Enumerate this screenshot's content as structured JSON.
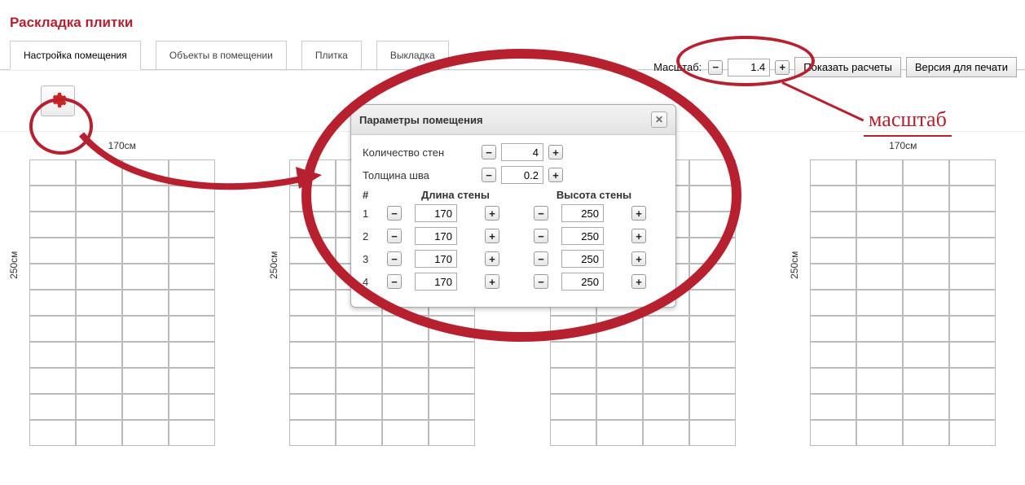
{
  "title": "Раскладка плитки",
  "tabs": [
    "Настройка помещения",
    "Объекты в помещении",
    "Плитка",
    "Выкладка"
  ],
  "active_tab": 0,
  "top": {
    "scale_label": "Масштаб:",
    "scale_value": "1.4",
    "show_calc": "Показать расчеты",
    "print_version": "Версия для печати"
  },
  "dialog": {
    "title": "Параметры помещения",
    "walls_count_label": "Количество стен",
    "walls_count": "4",
    "seam_label": "Толщина шва",
    "seam_value": "0.2",
    "head_idx": "#",
    "head_len": "Длина стены",
    "head_h": "Высота стены",
    "rows": [
      {
        "i": "1",
        "len": "170",
        "h": "250"
      },
      {
        "i": "2",
        "len": "170",
        "h": "250"
      },
      {
        "i": "3",
        "len": "170",
        "h": "250"
      },
      {
        "i": "4",
        "len": "170",
        "h": "250"
      }
    ]
  },
  "wall_label_w": "170см",
  "wall_label_h": "250см",
  "annotation_scale": "масштаб"
}
